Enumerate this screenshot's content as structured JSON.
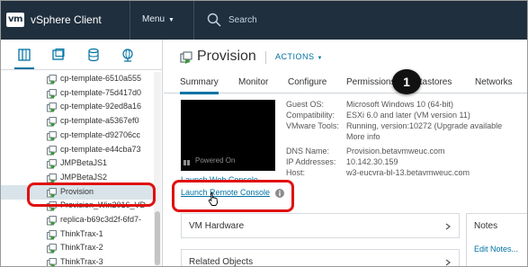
{
  "topbar": {
    "logo": "vm",
    "app_title": "vSphere Client",
    "menu_label": "Menu",
    "search_label": "Search"
  },
  "left_pane": {
    "tree_items": [
      {
        "label": "cp-template-6510a555"
      },
      {
        "label": "cp-template-75d417d0"
      },
      {
        "label": "cp-template-92ed8a16"
      },
      {
        "label": "cp-template-a5367ef0"
      },
      {
        "label": "cp-template-d92706cc"
      },
      {
        "label": "cp-template-e44cba73"
      },
      {
        "label": "JMPBetaJS1"
      },
      {
        "label": "JMPBetaJS2"
      },
      {
        "label": "Provision"
      },
      {
        "label": "Provision_Win2016_VD"
      },
      {
        "label": "replica-b69c3d2f-6fd7-"
      },
      {
        "label": "ThinkTrax-1"
      },
      {
        "label": "ThinkTrax-2"
      },
      {
        "label": "ThinkTrax-3"
      }
    ],
    "selected_index": 8
  },
  "object": {
    "title": "Provision",
    "actions_label": "ACTIONS"
  },
  "tabs": [
    {
      "label": "Summary"
    },
    {
      "label": "Monitor"
    },
    {
      "label": "Configure"
    },
    {
      "label": "Permissions"
    },
    {
      "label": "Datastores"
    },
    {
      "label": "Networks"
    }
  ],
  "console": {
    "status": "Powered On",
    "launch_web": "Launch Web Console",
    "launch_remote": "Launch Remote Console"
  },
  "properties": [
    {
      "label": "Guest OS:",
      "value": "Microsoft Windows 10 (64-bit)"
    },
    {
      "label": "Compatibility:",
      "value": "ESXi 6.0 and later (VM version 11)"
    },
    {
      "label": "VMware Tools:",
      "value": "Running, version:10272 (Upgrade available"
    },
    {
      "label": "",
      "value": "More info"
    },
    {
      "label": "DNS Name:",
      "value": "Provision.betavmweuc.com"
    },
    {
      "label": "IP Addresses:",
      "value": "10.142.30.159"
    },
    {
      "label": "Host:",
      "value": "w3-eucvra-bl-13.betavmweuc.com"
    }
  ],
  "panels": {
    "vm_hardware": "VM Hardware",
    "related_objects": "Related Objects",
    "notes": "Notes",
    "edit_notes": "Edit Notes..."
  },
  "annotation": {
    "step_number": "1",
    "highlight_color": "#e01010"
  },
  "colors": {
    "topbar": "#1f2f3e",
    "accent": "#0072a3",
    "selected_row": "#d9e4ea"
  }
}
